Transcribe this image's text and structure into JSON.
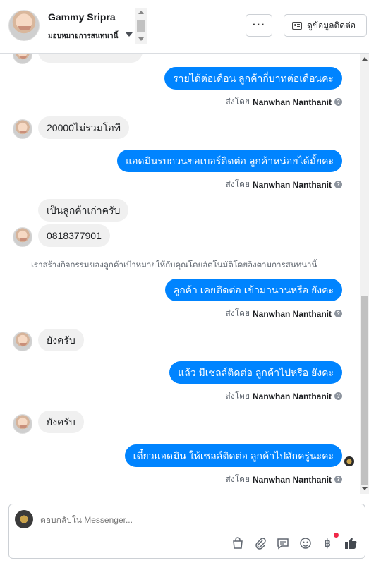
{
  "header": {
    "name": "Gammy Sripra",
    "assign_label": "มอบหมายการสนทนานี้",
    "more_label": "···",
    "contact_label": "ดูข้อมูลติดต่อ"
  },
  "messages": [
    {
      "dir": "out",
      "text": "รายได้ต่อเดือน ลูกค้ากี่บาทต่อเดือนคะ",
      "sent_prefix": "ส่งโดย",
      "sent_by": "Nanwhan Nanthanit"
    },
    {
      "dir": "in",
      "text": "20000ไม่รวมโอที"
    },
    {
      "dir": "out",
      "text": "แอดมินรบกวนขอเบอร์ติดต่อ ลูกค้าหน่อยได้มั้ยคะ",
      "sent_prefix": "ส่งโดย",
      "sent_by": "Nanwhan Nanthanit"
    },
    {
      "dir": "in",
      "text": "เป็นลูกค้าเก่าครับ"
    },
    {
      "dir": "in",
      "text": "0818377901"
    },
    {
      "dir": "system",
      "text": "เราสร้างกิจกรรมของลูกค้าเป้าหมายให้กับคุณโดยอัตโนมัติโดยอิงตามการสนทนานี้"
    },
    {
      "dir": "out",
      "text": "ลูกค้า เคยติดต่อ เข้ามานานหรือ ยังคะ",
      "sent_prefix": "ส่งโดย",
      "sent_by": "Nanwhan Nanthanit"
    },
    {
      "dir": "in",
      "text": "ยังครับ"
    },
    {
      "dir": "out",
      "text": "แล้ว มีเซลล์ติดต่อ ลูกค้าไปหรือ ยังคะ",
      "sent_prefix": "ส่งโดย",
      "sent_by": "Nanwhan Nanthanit"
    },
    {
      "dir": "in",
      "text": "ยังครับ"
    },
    {
      "dir": "out",
      "text": "เดี๋ยวแอดมิน ให้เซลล์ติดต่อ ลูกค้าไปสักครู่นะคะ",
      "sent_prefix": "ส่งโดย",
      "sent_by": "Nanwhan Nanthanit"
    }
  ],
  "composer": {
    "placeholder": "ตอบกลับใน Messenger...",
    "tools": [
      "shopping-bag-icon",
      "paperclip-icon",
      "saved-reply-icon",
      "emoji-icon",
      "baht-payment-icon",
      "thumbs-up-icon"
    ]
  },
  "colors": {
    "outgoing_bubble": "#0084ff",
    "incoming_bubble": "#f0f0f0",
    "notification_dot": "#f02849"
  }
}
